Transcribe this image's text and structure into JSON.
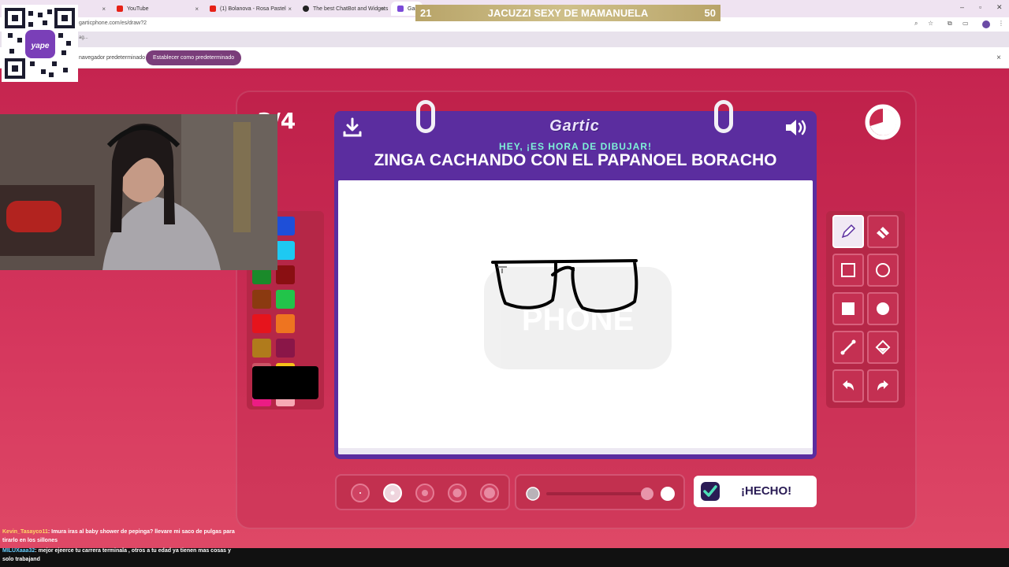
{
  "browser": {
    "tabs": [
      {
        "label": "",
        "icon": "tab-favicon"
      },
      {
        "label": "YouTube",
        "icon": "youtube-icon"
      },
      {
        "label": "(1) Bolanova - Rosa Pastel",
        "icon": "youtube-icon"
      },
      {
        "label": "The best ChatBot and Widgets",
        "icon": "github-icon"
      },
      {
        "label": "Gartic",
        "icon": "gartic-icon"
      }
    ],
    "url": "garticphone.com/es/draw?2",
    "bookmarks": "ag...",
    "infobar_text": "navegador predeterminado",
    "set_default_label": "Establecer como predeterminado",
    "close_label": "×"
  },
  "banner": {
    "left": "21",
    "title": "JACUZZI SEXY DE MAMANUELA",
    "right": "50"
  },
  "game": {
    "round_counter": "3/4",
    "logo": "Gartic",
    "hint": "HEY, ¡ES HORA DE DIBUJAR!",
    "prompt": "ZINGA CACHANDO CON EL PAPANOEL BORACHO",
    "done_label": "¡HECHO!",
    "watermark": "Gartic PHONE",
    "palette": [
      "#7a7a7a",
      "#1e4fd8",
      "#b3b3b3",
      "#1ec9f2",
      "#1a8a2a",
      "#8a0f12",
      "#8b3a10",
      "#22c44a",
      "#e6141c",
      "#ee7420",
      "#b07b1c",
      "#8a1648",
      "#cc5466",
      "#f6c21a",
      "#ec1c84",
      "#f7a8b4"
    ],
    "current_color": "#000000",
    "tools": [
      "pencil-tool",
      "eraser-tool",
      "rectangle-outline-tool",
      "ellipse-outline-tool",
      "rectangle-fill-tool",
      "ellipse-fill-tool",
      "line-tool",
      "fill-bucket-tool",
      "undo-tool",
      "redo-tool"
    ],
    "active_tool": "pencil-tool",
    "active_brush_size_index": 1,
    "opacity_level": 1.0
  },
  "chat": [
    {
      "user": "Kevin_Tasayco11",
      "text": ": Imura iras al baby shower de pepinga? llevare mi saco de pulgas para tirarlo en los sillones"
    },
    {
      "user": "MILUXaaa32",
      "text": ": mejor ejeerce tu carrera terminala , otros a tu edad ya tienen mas cosas y solo trabajand"
    }
  ]
}
